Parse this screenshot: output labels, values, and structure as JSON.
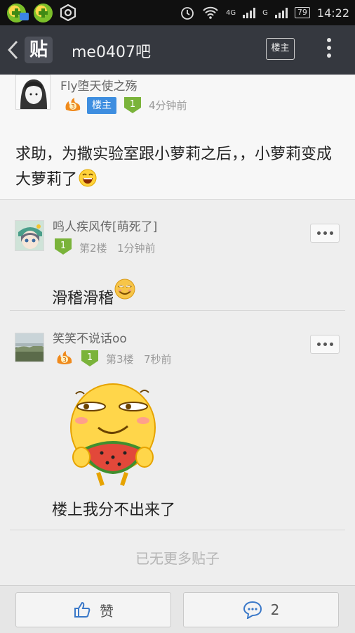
{
  "status_bar": {
    "network": "4G",
    "network2": "G",
    "battery": "79",
    "time": "14:22"
  },
  "header": {
    "back_icon": "chevron-left-icon",
    "logo_text": "贴",
    "title": "me0407吧",
    "louzhu_button": "楼主",
    "more_icon": "vertical-dots-icon"
  },
  "main_post": {
    "username": "Fly堕天使之殇",
    "fire_level": "3",
    "role_badge": "楼主",
    "level": "1",
    "time": "4分钟前",
    "content": "求助，为撒实验室跟小萝莉之后，，小萝莉变成大萝莉了"
  },
  "replies": [
    {
      "username": "鸣人疾风传[萌死了]",
      "level": "1",
      "floor": "第2楼",
      "time": "1分钟前",
      "content": "滑稽滑稽"
    },
    {
      "username": "笑笑不说话oo",
      "fire_level": "3",
      "level": "1",
      "floor": "第3楼",
      "time": "7秒前",
      "content": "楼上我分不出来了"
    }
  ],
  "no_more": "已无更多贴子",
  "bottom_bar": {
    "like_label": "赞",
    "comment_count": "2"
  },
  "colors": {
    "header_bg": "#35383f",
    "badge_blue": "#3e8ee0",
    "level_green": "#7ab33a"
  }
}
